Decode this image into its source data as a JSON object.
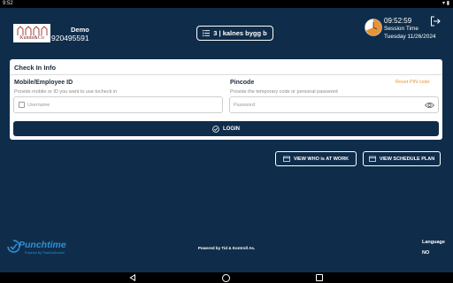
{
  "status_bar": {
    "time": "9:52",
    "battery_icon": "battery-icon",
    "wifi_icon": "wifi-icon"
  },
  "company": {
    "logo_text": "Kunde&Co",
    "name": "Demo",
    "number": "920495591"
  },
  "project": {
    "label": "3 | kalnes bygg b",
    "icon": "list-icon"
  },
  "session": {
    "time": "09:52:59",
    "label": "Session Time",
    "date": "Tuesday 11/26/2024"
  },
  "checkin": {
    "title": "Check In Info",
    "mobile": {
      "label": "Mobile/Employee ID",
      "help": "Provide mobile or ID you want to use tocheck in",
      "placeholder": "Username",
      "value": ""
    },
    "pincode": {
      "label": "Pincode",
      "help": "Provide the temporary code or personal password",
      "placeholder": "Password",
      "value": "",
      "reset_link": "Reset PIN code"
    },
    "login_label": "LOGIN"
  },
  "actions": {
    "view_who": "VIEW WHO is AT WORK",
    "view_schedule": "VIEW SCHEDULE PLAN"
  },
  "footer": {
    "brand_name": "Punchtime",
    "brand_sub": "Powered By TimeAndControl",
    "powered_by": "Powered by Tid & Kontroll As.",
    "language_label": "Language",
    "language_value": "NO"
  },
  "colors": {
    "background": "#0f2d4a",
    "card": "#ffffff",
    "accent_link": "#e8953a",
    "brand": "#2e8fd6"
  }
}
